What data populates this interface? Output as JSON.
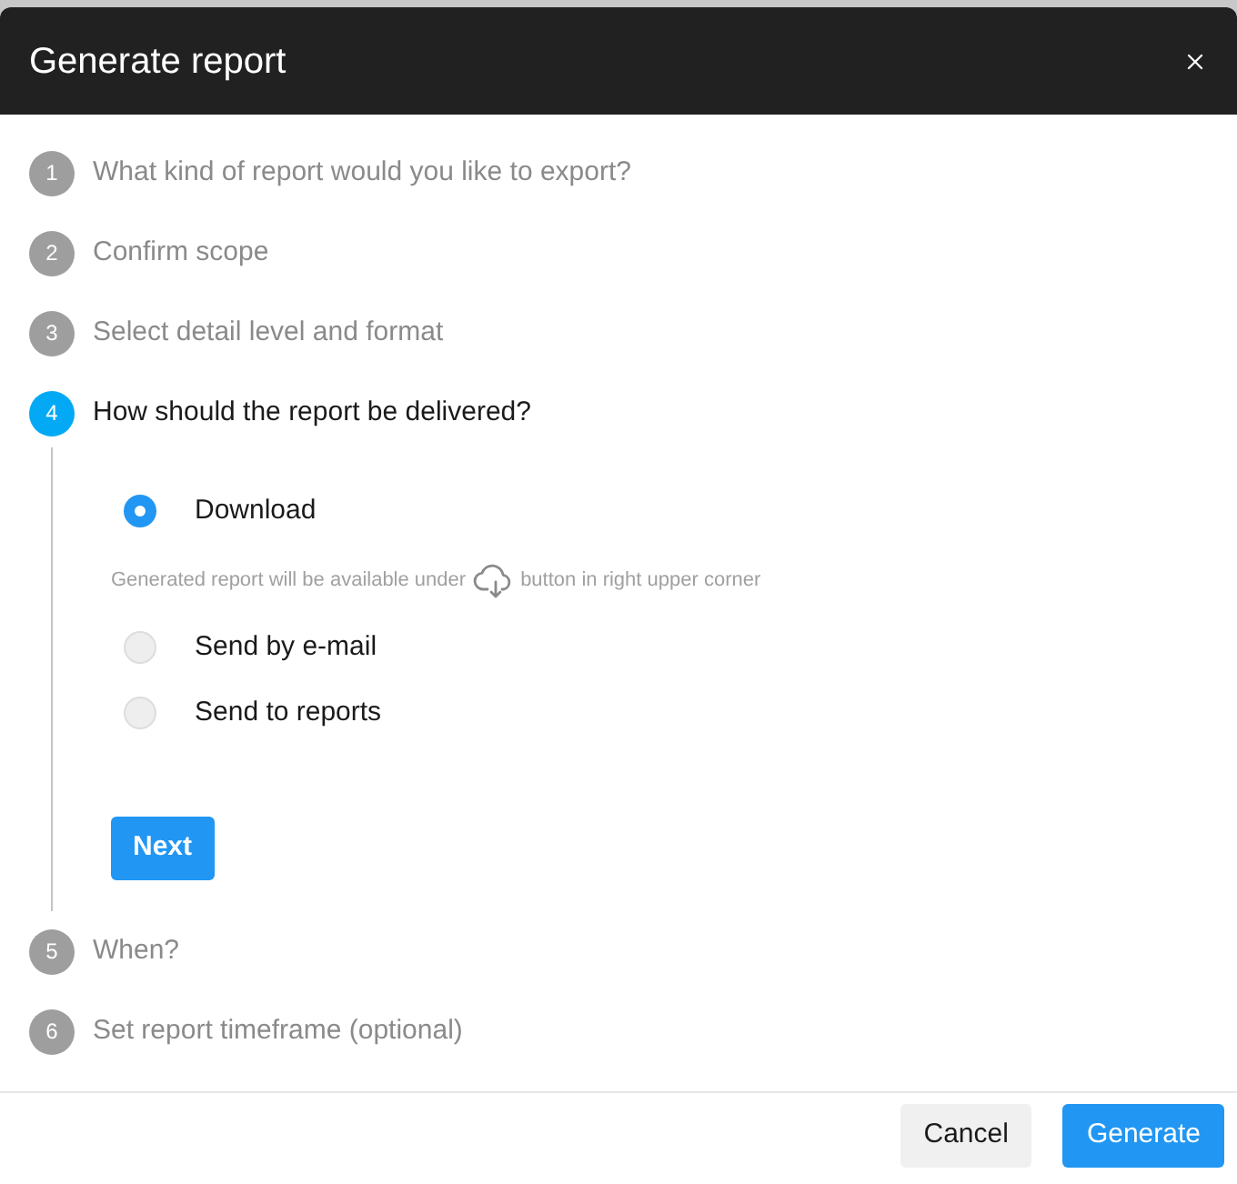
{
  "dialog": {
    "title": "Generate report"
  },
  "steps": [
    {
      "number": "1",
      "label": "What kind of report would you like to export?",
      "active": false
    },
    {
      "number": "2",
      "label": "Confirm scope",
      "active": false
    },
    {
      "number": "3",
      "label": "Select detail level and format",
      "active": false
    },
    {
      "number": "4",
      "label": "How should the report be delivered?",
      "active": true,
      "options": [
        {
          "label": "Download",
          "selected": true,
          "hint": {
            "before": "Generated report will be available under",
            "after": "button in right upper corner"
          }
        },
        {
          "label": "Send by e-mail",
          "selected": false
        },
        {
          "label": "Send to reports",
          "selected": false
        }
      ],
      "next_button": "Next"
    },
    {
      "number": "5",
      "label": "When?",
      "active": false
    },
    {
      "number": "6",
      "label": "Set report timeframe (optional)",
      "active": false
    }
  ],
  "footer": {
    "buttons": [
      {
        "label": "Cancel",
        "kind": "secondary"
      },
      {
        "label": "Generate",
        "kind": "primary"
      }
    ]
  }
}
